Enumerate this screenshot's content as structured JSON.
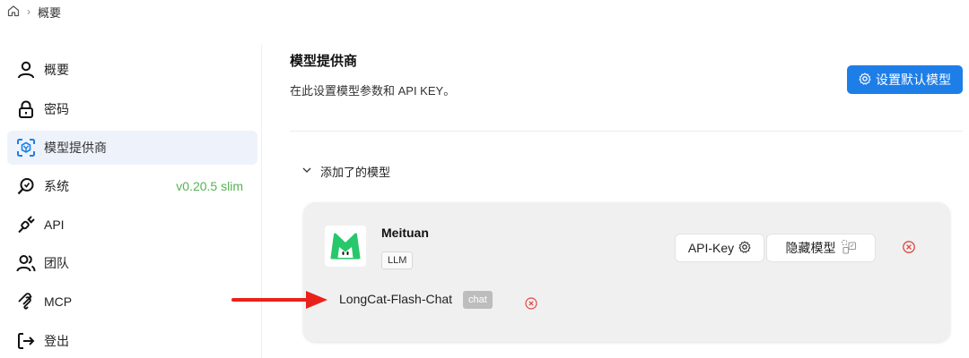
{
  "breadcrumb": {
    "home_icon": "home-icon",
    "current": "概要"
  },
  "sidebar": {
    "items": [
      {
        "label": "概要",
        "icon": "user-icon",
        "extra": ""
      },
      {
        "label": "密码",
        "icon": "lock-icon",
        "extra": ""
      },
      {
        "label": "模型提供商",
        "icon": "model-cube-icon",
        "extra": "",
        "active": true
      },
      {
        "label": "系统",
        "icon": "system-search-icon",
        "extra": "v0.20.5 slim"
      },
      {
        "label": "API",
        "icon": "plug-icon",
        "extra": ""
      },
      {
        "label": "团队",
        "icon": "team-icon",
        "extra": ""
      },
      {
        "label": "MCP",
        "icon": "mcp-icon",
        "extra": ""
      },
      {
        "label": "登出",
        "icon": "logout-icon",
        "extra": ""
      }
    ]
  },
  "main": {
    "title": "模型提供商",
    "subtitle": "在此设置模型参数和 API KEY。",
    "default_model_button": "设置默认模型",
    "section_label": "添加了的模型"
  },
  "provider": {
    "name": "Meituan",
    "type_tag": "LLM",
    "api_key_button": "API-Key",
    "hide_models_button": "隐藏模型",
    "models": [
      {
        "name": "LongCat-Flash-Chat",
        "tag": "chat"
      }
    ]
  },
  "colors": {
    "accent": "#1e7ee8",
    "version_green": "#52b452",
    "delete_red": "#e0453f",
    "arrow_red": "#e8221b",
    "logo_green": "#27c86b"
  }
}
